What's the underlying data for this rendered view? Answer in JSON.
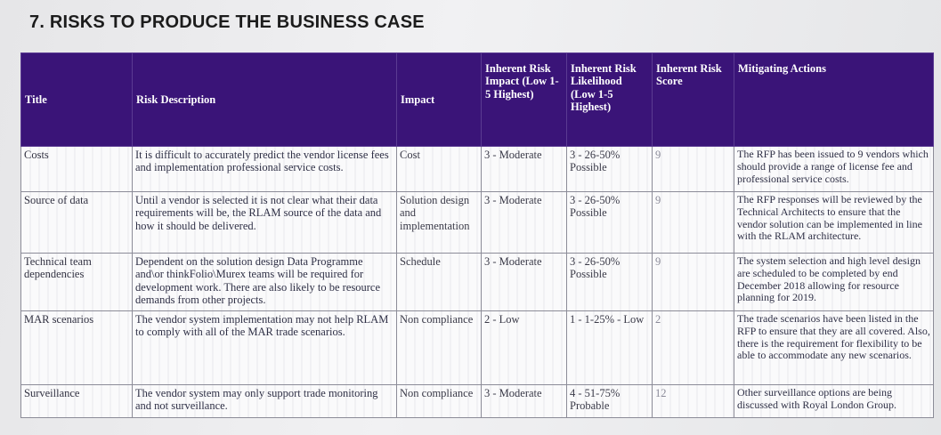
{
  "heading": "7. RISKS TO PRODUCE THE BUSINESS CASE",
  "columns": {
    "title": "Title",
    "description": "Risk Description",
    "impact": "Impact",
    "inherent_impact": "Inherent Risk Impact (Low 1-5 Highest)",
    "inherent_likelihood": "Inherent Risk Likelihood (Low 1-5 Highest)",
    "inherent_score": "Inherent Risk Score",
    "mitigating": "Mitigating Actions"
  },
  "rows": [
    {
      "title": "Costs",
      "description": "It is difficult to accurately predict the vendor license fees and implementation professional service costs.",
      "impact": "Cost",
      "inherent_impact": "3 - Moderate",
      "inherent_likelihood": "3 - 26-50% Possible",
      "score": "9",
      "mitigating": "The RFP has been issued to 9 vendors which should provide a range of license fee and professional service costs."
    },
    {
      "title": "Source of data",
      "description": "Until a vendor is selected it is not clear what their data requirements will be, the RLAM source of the data and how it should be delivered.",
      "impact": "Solution design and implementation",
      "inherent_impact": "3 - Moderate",
      "inherent_likelihood": "3 - 26-50% Possible",
      "score": "9",
      "mitigating": "The RFP responses will be reviewed by the Technical Architects to ensure that the vendor solution can be implemented in line with the RLAM architecture."
    },
    {
      "title": "Technical team dependencies",
      "description": "Dependent on the solution design Data Programme and\\or thinkFolio\\Murex teams will be required for development work. There are also likely to be resource demands from other projects.",
      "impact": "Schedule",
      "inherent_impact": "3 - Moderate",
      "inherent_likelihood": "3 - 26-50% Possible",
      "score": "9",
      "mitigating": "The system selection and high level design are scheduled to be completed by end December 2018 allowing for resource planning for 2019."
    },
    {
      "title": "MAR scenarios",
      "description": "The vendor system implementation may not help RLAM to comply with all of the MAR trade scenarios.",
      "impact": "Non compliance",
      "inherent_impact": "2 - Low",
      "inherent_likelihood": "1 - 1-25% - Low",
      "score": "2",
      "mitigating": "The trade scenarios have been listed in the RFP to ensure that they are all covered. Also, there is the requirement for flexibility to be able to accommodate any new scenarios."
    },
    {
      "title": "Surveillance",
      "description": "The vendor system may only support trade monitoring and not surveillance.",
      "impact": "Non compliance",
      "inherent_impact": "3 - Moderate",
      "inherent_likelihood": "4 - 51-75% Probable",
      "score": "12",
      "mitigating": "Other surveillance options are being discussed with Royal London Group."
    }
  ]
}
